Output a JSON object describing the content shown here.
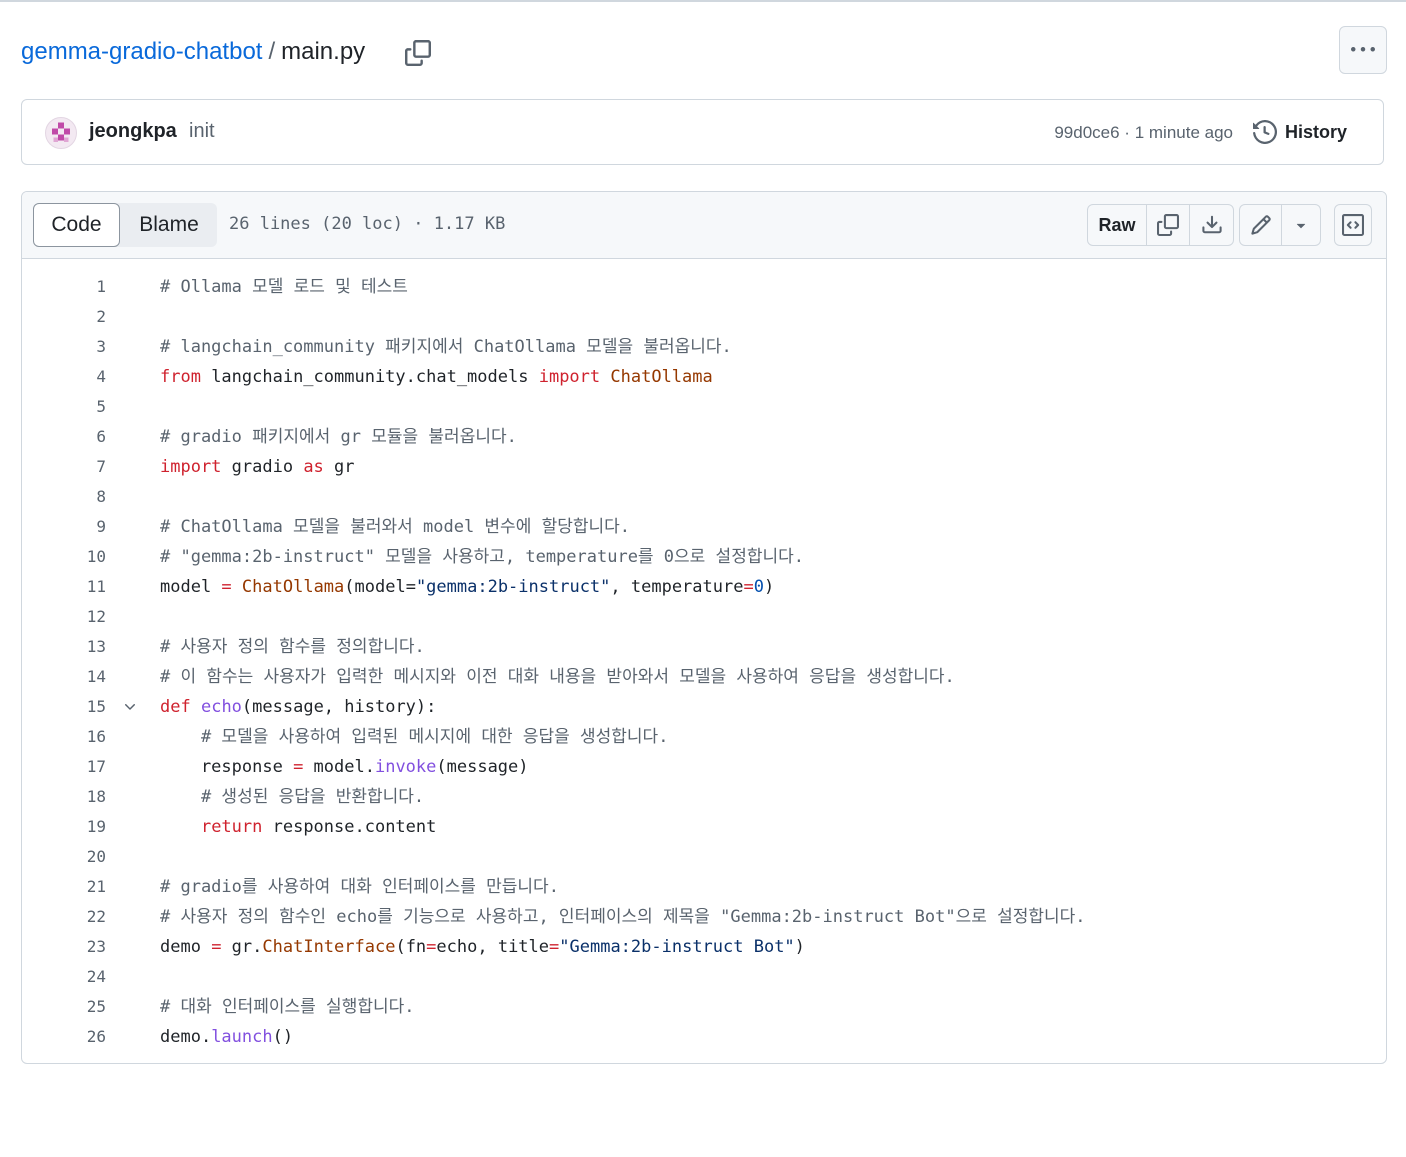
{
  "breadcrumb": {
    "repo": "gemma-gradio-chatbot",
    "separator": "/",
    "file": "main.py"
  },
  "commit": {
    "author": "jeongkpa",
    "message": "init",
    "hash": "99d0ce6",
    "dot": "·",
    "time": "1 minute ago",
    "history_label": "History"
  },
  "toolbar": {
    "code_tab": "Code",
    "blame_tab": "Blame",
    "file_info": "26 lines (20 loc) · 1.17 KB",
    "raw_label": "Raw"
  },
  "colors": {
    "link": "#0969da",
    "comment": "#59636e",
    "keyword": "#cf222e",
    "function": "#8250df",
    "class": "#953800",
    "string": "#0a3069",
    "number": "#0550ae"
  },
  "code_lines": [
    {
      "n": "1",
      "tokens": [
        [
          "c",
          "# Ollama 모델 로드 및 테스트"
        ]
      ]
    },
    {
      "n": "2",
      "tokens": []
    },
    {
      "n": "3",
      "tokens": [
        [
          "c",
          "# langchain_community 패키지에서 ChatOllama 모델을 불러옵니다."
        ]
      ]
    },
    {
      "n": "4",
      "tokens": [
        [
          "k",
          "from"
        ],
        [
          "p",
          " langchain_community.chat_models "
        ],
        [
          "k",
          "import"
        ],
        [
          "p",
          " "
        ],
        [
          "cls",
          "ChatOllama"
        ]
      ]
    },
    {
      "n": "5",
      "tokens": []
    },
    {
      "n": "6",
      "tokens": [
        [
          "c",
          "# gradio 패키지에서 gr 모듈을 불러옵니다."
        ]
      ]
    },
    {
      "n": "7",
      "tokens": [
        [
          "k",
          "import"
        ],
        [
          "p",
          " gradio "
        ],
        [
          "k",
          "as"
        ],
        [
          "p",
          " gr"
        ]
      ]
    },
    {
      "n": "8",
      "tokens": []
    },
    {
      "n": "9",
      "tokens": [
        [
          "c",
          "# ChatOllama 모델을 불러와서 model 변수에 할당합니다."
        ]
      ]
    },
    {
      "n": "10",
      "tokens": [
        [
          "c",
          "# \"gemma:2b-instruct\" 모델을 사용하고, temperature를 0으로 설정합니다."
        ]
      ]
    },
    {
      "n": "11",
      "tokens": [
        [
          "p",
          "model "
        ],
        [
          "k",
          "="
        ],
        [
          "p",
          " "
        ],
        [
          "cls",
          "ChatOllama"
        ],
        [
          "p",
          "(model="
        ],
        [
          "s",
          "\"gemma:2b-instruct\""
        ],
        [
          "p",
          ", temperature"
        ],
        [
          "k",
          "="
        ],
        [
          "n",
          "0"
        ],
        [
          "p",
          ")"
        ]
      ]
    },
    {
      "n": "12",
      "tokens": []
    },
    {
      "n": "13",
      "tokens": [
        [
          "c",
          "# 사용자 정의 함수를 정의합니다."
        ]
      ]
    },
    {
      "n": "14",
      "tokens": [
        [
          "c",
          "# 이 함수는 사용자가 입력한 메시지와 이전 대화 내용을 받아와서 모델을 사용하여 응답을 생성합니다."
        ]
      ]
    },
    {
      "n": "15",
      "fold": true,
      "tokens": [
        [
          "k",
          "def"
        ],
        [
          "p",
          " "
        ],
        [
          "f",
          "echo"
        ],
        [
          "p",
          "(message, history):"
        ]
      ]
    },
    {
      "n": "16",
      "tokens": [
        [
          "p",
          "    "
        ],
        [
          "c",
          "# 모델을 사용하여 입력된 메시지에 대한 응답을 생성합니다."
        ]
      ]
    },
    {
      "n": "17",
      "tokens": [
        [
          "p",
          "    response "
        ],
        [
          "k",
          "="
        ],
        [
          "p",
          " model."
        ],
        [
          "f",
          "invoke"
        ],
        [
          "p",
          "(message)"
        ]
      ]
    },
    {
      "n": "18",
      "tokens": [
        [
          "p",
          "    "
        ],
        [
          "c",
          "# 생성된 응답을 반환합니다."
        ]
      ]
    },
    {
      "n": "19",
      "tokens": [
        [
          "p",
          "    "
        ],
        [
          "k",
          "return"
        ],
        [
          "p",
          " response.content"
        ]
      ]
    },
    {
      "n": "20",
      "tokens": []
    },
    {
      "n": "21",
      "tokens": [
        [
          "c",
          "# gradio를 사용하여 대화 인터페이스를 만듭니다."
        ]
      ]
    },
    {
      "n": "22",
      "tokens": [
        [
          "c",
          "# 사용자 정의 함수인 echo를 기능으로 사용하고, 인터페이스의 제목을 \"Gemma:2b-instruct Bot\"으로 설정합니다."
        ]
      ]
    },
    {
      "n": "23",
      "tokens": [
        [
          "p",
          "demo "
        ],
        [
          "k",
          "="
        ],
        [
          "p",
          " gr."
        ],
        [
          "cls",
          "ChatInterface"
        ],
        [
          "p",
          "(fn"
        ],
        [
          "k",
          "="
        ],
        [
          "p",
          "echo, title"
        ],
        [
          "k",
          "="
        ],
        [
          "s",
          "\"Gemma:2b-instruct Bot\""
        ],
        [
          "p",
          ")"
        ]
      ]
    },
    {
      "n": "24",
      "tokens": []
    },
    {
      "n": "25",
      "tokens": [
        [
          "c",
          "# 대화 인터페이스를 실행합니다."
        ]
      ]
    },
    {
      "n": "26",
      "tokens": [
        [
          "p",
          "demo."
        ],
        [
          "f",
          "launch"
        ],
        [
          "p",
          "()"
        ]
      ]
    }
  ]
}
